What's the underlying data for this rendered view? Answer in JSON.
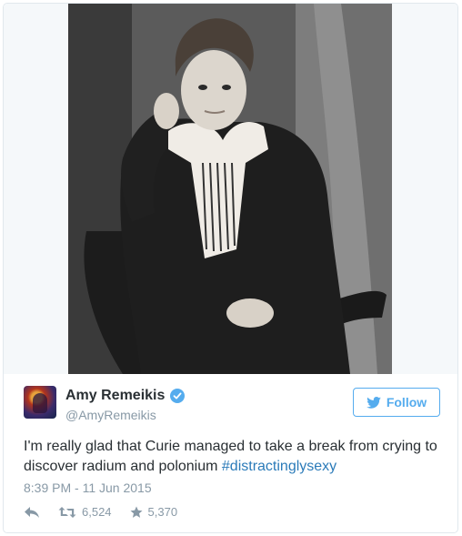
{
  "tweet": {
    "author": {
      "name": "Amy Remeikis",
      "handle": "@AmyRemeikis",
      "verified": true,
      "avatar_icon": "avatar-image"
    },
    "follow_label": "Follow",
    "text_main": "I'm really glad that Curie managed to take a break from crying to discover radium and polonium",
    "hashtag": "#distractinglysexy",
    "timestamp": "8:39 PM - 11 Jun 2015",
    "stats": {
      "retweets": "6,524",
      "likes": "5,370"
    },
    "media": {
      "type": "photo",
      "colors": [
        "#3b3b3b",
        "#5a5a5a",
        "#8a8a8a"
      ]
    }
  },
  "colors": {
    "accent": "#55acee",
    "hashtag": "#2b7bb9",
    "muted": "#8899a6",
    "text": "#292f33",
    "border": "#e1e8ed"
  }
}
